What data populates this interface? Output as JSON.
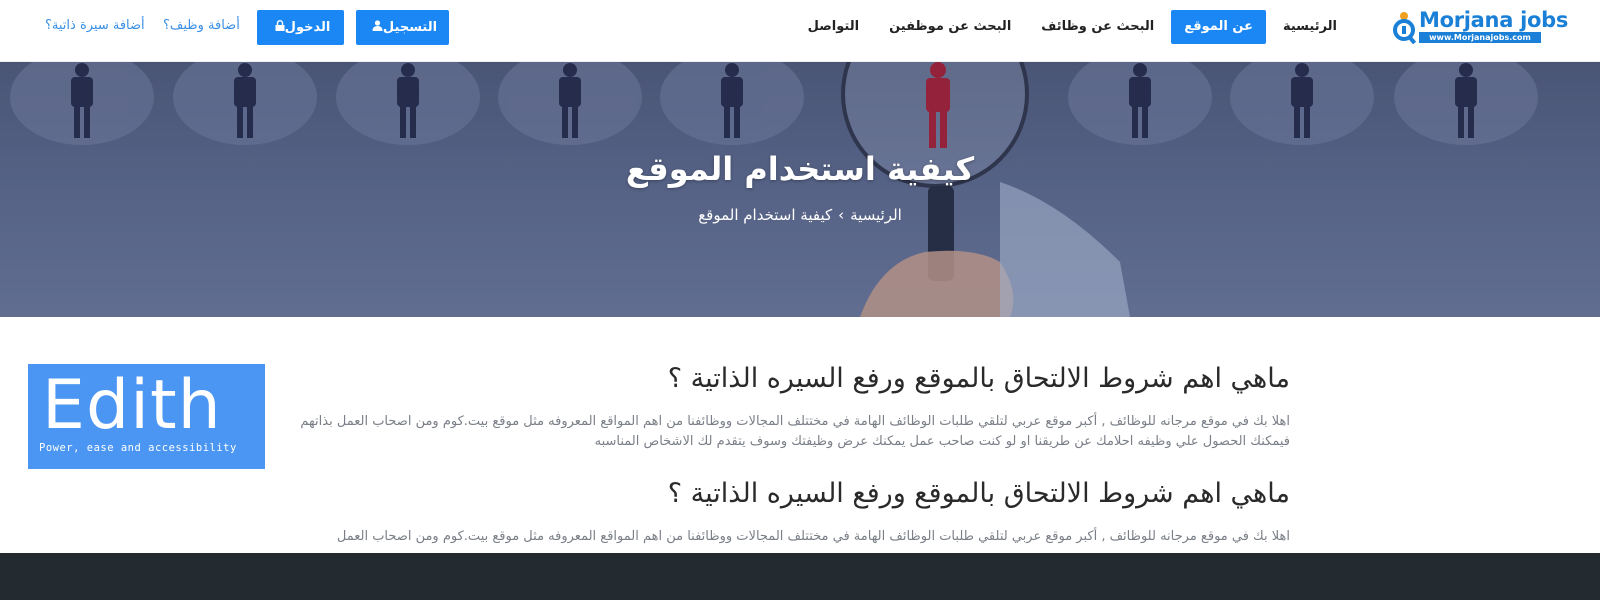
{
  "brand": {
    "name": "Morjana jobs",
    "url": "www.Morjanajobs.com"
  },
  "nav": {
    "items": [
      {
        "label": "الرئيسية",
        "active": false
      },
      {
        "label": "عن الموقع",
        "active": true
      },
      {
        "label": "البحث عن وظائف",
        "active": false
      },
      {
        "label": "البحث عن موظفين",
        "active": false
      },
      {
        "label": "التواصل",
        "active": false
      }
    ]
  },
  "auth": {
    "register_label": "التسجيل",
    "login_label": "الدخول",
    "add_job_label": "أضافة وظيف؟",
    "add_cv_label": "أضافة سيرة ذاتية؟"
  },
  "hero": {
    "title": "كيفية استخدام الموقع",
    "breadcrumb_home": "الرئيسية",
    "breadcrumb_separator": "›",
    "breadcrumb_current": "كيفية استخدام الموقع"
  },
  "ad": {
    "title": "Edith",
    "tagline": "Power, ease and accessibility"
  },
  "articles": [
    {
      "heading": "ماهي اهم شروط الالتحاق بالموقع ورفع السيره الذاتية ؟",
      "body": "اهلا بك في موقع مرجانه للوظائف , أكبر موقع عربي لتلقي طلبات الوظائف الهامة في مختتلف المجالات ووظائفنا من اهم المواقع المعروفه مثل موقع بيت.كوم ومن اصحاب العمل بذاتهم فيمكنك الحصول علي وظيفه احلامك عن طريقنا او لو كنت صاحب عمل يمكنك عرض وظيفتك وسوف يتقدم لك الاشخاص المناسبه"
    },
    {
      "heading": "ماهي اهم شروط الالتحاق بالموقع ورفع السيره الذاتية ؟",
      "body": "اهلا بك في موقع مرجانه للوظائف , أكبر موقع عربي لتلقي طلبات الوظائف الهامة في مختتلف المجالات ووظائفنا من اهم المواقع المعروفه مثل موقع بيت.كوم ومن اصحاب العمل"
    }
  ],
  "colors": {
    "accent": "#1a87f5",
    "footer": "#232a30",
    "ad_bg": "#4a96f2"
  }
}
